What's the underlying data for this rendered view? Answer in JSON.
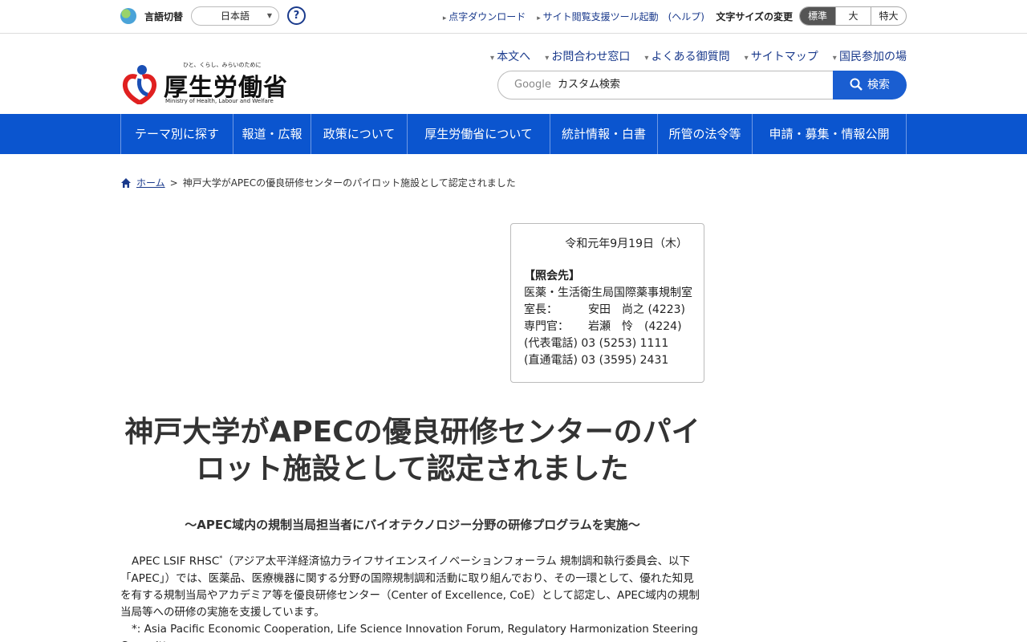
{
  "utility": {
    "lang_label": "言語切替",
    "lang_value": "日本語",
    "help": "?",
    "links": [
      "点字ダウンロード",
      "サイト閲覧支援ツール起動　(ヘルプ)"
    ],
    "font_label": "文字サイズの変更",
    "font_sizes": [
      "標準",
      "大",
      "特大"
    ]
  },
  "header": {
    "logo_tagline": "ひと、くらし、みらいのために",
    "logo_name": "厚生労働省",
    "logo_en": "Ministry of Health, Labour and Welfare",
    "links": [
      "本文へ",
      "お問合わせ窓口",
      "よくある御質問",
      "サイトマップ",
      "国民参加の場"
    ],
    "search_google": "Google",
    "search_placeholder": "カスタム検索",
    "search_button": "検索"
  },
  "gnav": [
    "テーマ別に探す",
    "報道・広報",
    "政策について",
    "厚生労働省について",
    "統計情報・白書",
    "所管の法令等",
    "申請・募集・情報公開"
  ],
  "breadcrumb": {
    "home": "ホーム",
    "sep": ">",
    "current": "神戸大学がAPECの優良研修センターのパイロット施設として認定されました"
  },
  "contact": {
    "date": "令和元年9月19日（木）",
    "heading": "【照会先】",
    "dept": "医薬・生活衛生局国際薬事規制室",
    "rows": [
      {
        "label": "室長：",
        "value": "安田　尚之 (4223)"
      },
      {
        "label": "専門官：",
        "value": "岩瀬　怜　(4224)"
      }
    ],
    "tel_rep": "(代表電話) 03 (5253) 1111",
    "tel_direct": "(直通電話) 03 (3595) 2431"
  },
  "main": {
    "title": "神戸大学がAPECの優良研修センターのパイロット施設として認定されました",
    "subtitle": "～APEC域内の規制当局担当者にバイオテクノロジー分野の研修プログラムを実施～",
    "para_lead": "APEC LSIF RHSC",
    "para_sup": "*",
    "para_rest": "（アジア太平洋経済協力ライフサイエンスイノベーションフォーラム 規制調和執行委員会、以下「APEC」）では、医薬品、医療機器に関する分野の国際規制調和活動に取り組んでおり、その一環として、優れた知見を有する規制当局やアカデミア等を優良研修センター（Center of Excellence, CoE）として認定し、APEC域内の規制当局等への研修の実施を支援しています。",
    "footnote": "*: Asia Pacific Economic Cooperation, Life Science Innovation Forum, Regulatory Harmonization Steering Committee"
  }
}
